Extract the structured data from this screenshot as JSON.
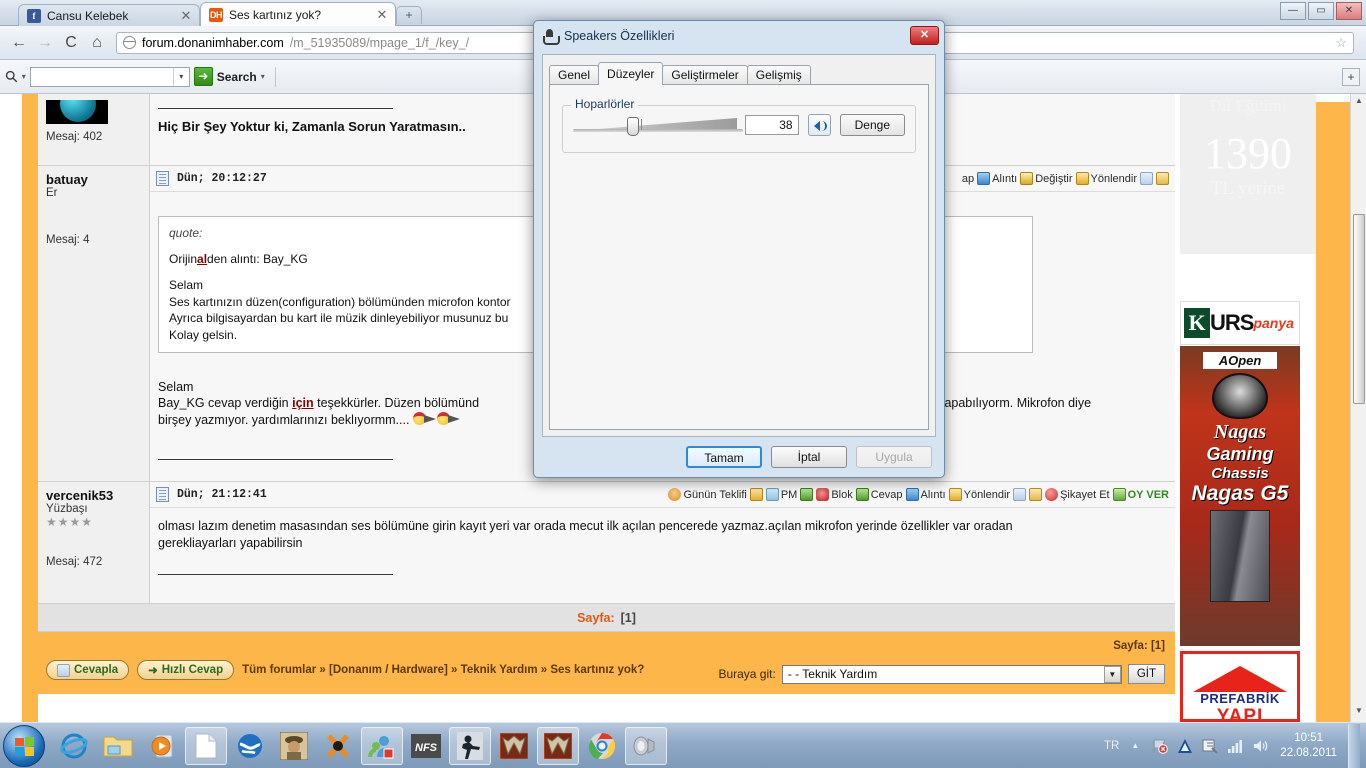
{
  "browser": {
    "tabs": [
      {
        "title": "Cansu Kelebek",
        "favicon": "facebook-icon",
        "favicon_text": "f",
        "active": false
      },
      {
        "title": "Ses kartınız yok?",
        "favicon": "donanimhaber-icon",
        "favicon_text": "DH",
        "active": true
      }
    ],
    "new_tab_label": "+",
    "window_buttons": {
      "minimize": "—",
      "maximize": "▭",
      "close": "✕"
    },
    "nav": {
      "back": "←",
      "forward": "→",
      "reload": "C",
      "home": "⌂",
      "bookmark": "☆"
    },
    "url": {
      "host": "forum.donanimhaber.com",
      "path": "/m_51935089/mpage_1/f_/key_/"
    },
    "toolbar2": {
      "search_placeholder": "",
      "search_value": "",
      "search_label": "Search",
      "dropdown_caret": "▾",
      "plus_label": "+"
    }
  },
  "forum": {
    "post0": {
      "message_count": "Mesaj: 402",
      "signature": "Hiç Bir Şey Yoktur ki, Zamanla Sorun Yaratmasın.."
    },
    "post1": {
      "username": "batuay",
      "rank": "Er",
      "message_count": "Mesaj: 4",
      "time": "Dün; 20:12:27",
      "actions": [
        "ap",
        "Alıntı",
        "Değiştir",
        "Yönlendir"
      ],
      "quote": {
        "label": "quote:",
        "from_prefix": "Orijin",
        "from_bold": "al",
        "from_suffix": "den alıntı: Bay_KG",
        "line1": "Selam",
        "line2": "Ses kartınızın düzen(configuration) bölümünden microfon kontor",
        "line3": "Ayrıca bilgisayardan bu kart ile müzik dinleyebiliyor musunuz bu",
        "line4": "Kolay gelsin."
      },
      "body_line1": "Selam",
      "body_line2_a": "Bay_KG cevap verdiğin ",
      "body_line2_link": "için",
      "body_line2_b": " teşekkürler. Düzen bölümünd",
      "body_line2_c": "imini yapabılıyorm. Mikrofon diye",
      "body_line3": "birşey yazmıyor. yardımlarınızı beklıyormm...."
    },
    "post2": {
      "username": "vercenik53",
      "rank": "Yüzbaşı",
      "stars": "★★★★",
      "message_count": "Mesaj: 472",
      "time": "Dün; 21:12:41",
      "actions": [
        "Günün Teklifi",
        "PM",
        "Blok",
        "Cevap",
        "Alıntı",
        "Yönlendir",
        "Şikayet Et",
        "OY VER"
      ],
      "body_line1": "olması lazım denetim masasından ses bölümüne girin kayıt yeri var orada mecut ilk açılan pencerede yazmaz.açılan mikrofon yerinde özellikler var oradan",
      "body_line2": "gerekliayarları yapabilirsin"
    },
    "pagination": {
      "label": "Sayfa:",
      "pages": "[1]"
    },
    "footer": {
      "reply_button": "Cevapla",
      "quick_reply_button": "Hızlı Cevap",
      "breadcrumb": "Tüm forumlar » [Donanım / Hardware] » Teknik Yardım » Ses kartınız yok?",
      "page_right_label": "Sayfa:",
      "page_right_value": "[1]",
      "goto_label": "Buraya git:",
      "goto_value": "- - Teknik Yardım",
      "goto_button": "GİT"
    }
  },
  "ads": {
    "dil": {
      "line1": "Dil Eğitimi",
      "line2": "1390",
      "line3": "TL yerine"
    },
    "kurs": {
      "k": "K",
      "urs": "URS",
      "panya": "panya"
    },
    "aopen": {
      "brand": "AOpen",
      "nagas": "Nagas",
      "gaming": "Gaming",
      "chassis": "Chassis",
      "model": "Nagas G5"
    },
    "prefabrik": {
      "line1": "PREFABRİK",
      "line2": "YAPI"
    }
  },
  "dialog": {
    "title": "Speakers Özellikleri",
    "close_label": "✕",
    "tabs": [
      {
        "label": "Genel",
        "selected": false
      },
      {
        "label": "Düzeyler",
        "selected": true
      },
      {
        "label": "Geliştirmeler",
        "selected": false
      },
      {
        "label": "Gelişmiş",
        "selected": false
      }
    ],
    "group_label": "Hoparlörler",
    "volume_value": "38",
    "mute_icon": "speaker-icon",
    "balance_button": "Denge",
    "buttons": {
      "ok": "Tamam",
      "cancel": "İptal",
      "apply": "Uygula"
    }
  },
  "taskbar": {
    "start": "windows-start-icon",
    "items": [
      "internet-explorer-icon",
      "windows-explorer-icon",
      "media-player-icon",
      "notepad-document-icon",
      "google-earth-icon",
      "game-character-icon",
      "xfire-icon",
      "msn-messenger-icon",
      "nfs-icon",
      "counter-strike-icon",
      "warcraft-icon",
      "warcraft-icon-2",
      "google-chrome-icon",
      "volume-control-icon"
    ],
    "tray": {
      "language": "TR",
      "show_hidden": "▲",
      "network_flag": "network-flag-icon",
      "avira_icon": "avira-icon",
      "device_icon": "device-icon",
      "signal_icon": "signal-bars-icon",
      "volume_icon": "volume-icon",
      "time": "10:51",
      "date": "22.08.2011"
    }
  }
}
